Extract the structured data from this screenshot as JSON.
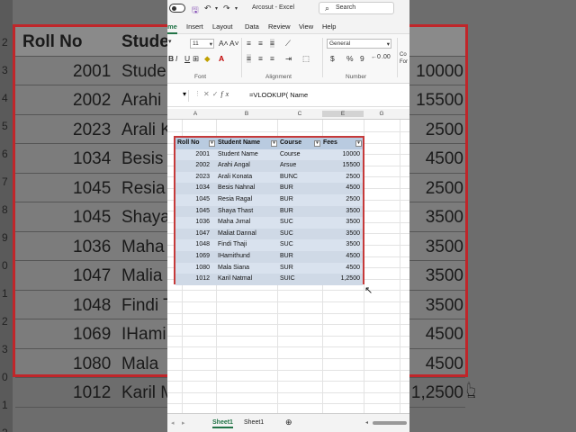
{
  "background": {
    "header": [
      "Roll No",
      "Stude"
    ],
    "rows": [
      [
        "2001",
        "Stude",
        "10000"
      ],
      [
        "2002",
        "Arahi",
        "15500"
      ],
      [
        "2023",
        "Arali K",
        "2500"
      ],
      [
        "1034",
        "Besis",
        "4500"
      ],
      [
        "1045",
        "Resia",
        "2500"
      ],
      [
        "1045",
        "Shaya",
        "3500"
      ],
      [
        "1036",
        "Maha",
        "3500"
      ],
      [
        "1047",
        "Malia",
        "3500"
      ],
      [
        "1048",
        "Findi T",
        "3500"
      ],
      [
        "1069",
        "IHami",
        "4500"
      ],
      [
        "1080",
        "Mala",
        "4500"
      ],
      [
        "1012",
        "Karil M",
        "1,2500"
      ]
    ],
    "row_numbers": [
      "2",
      "3",
      "4",
      "5",
      "6",
      "7",
      "8",
      "9",
      "0",
      "1",
      "2",
      "3",
      "0",
      "1",
      "2"
    ]
  },
  "titlebar": {
    "document": "Arcosut  -  Excel",
    "search_placeholder": "Search"
  },
  "tabs": [
    "me",
    "Insert",
    "Layout",
    "Data",
    "Review",
    "View",
    "Help"
  ],
  "ribbon": {
    "font_size": "11",
    "number_format": "General",
    "group_font": "Font",
    "group_alignment": "Alignment",
    "group_number": "Number",
    "currency": "$",
    "percent": "%",
    "comma": "9",
    "bold": "B",
    "italic": "I",
    "underline": "U",
    "cond_partial": "Co",
    "fmt_partial": "For"
  },
  "formula_bar": {
    "name_box": "",
    "formula": "=VLOOKUP( Name"
  },
  "columns": [
    "A",
    "B",
    "C",
    "E",
    "G"
  ],
  "table": {
    "headers": [
      "Roll No",
      "Student Name",
      "Course",
      "Fees"
    ],
    "rows": [
      [
        "2001",
        "Student Name",
        "Course",
        "10000"
      ],
      [
        "2002",
        "Arahi Angal",
        "Arsue",
        "15500"
      ],
      [
        "2023",
        "Arali Konata",
        "BUNC",
        "2500"
      ],
      [
        "1034",
        "Besis Nahnal",
        "BUR",
        "4500"
      ],
      [
        "1045",
        "Resia Ragal",
        "BUR",
        "2500"
      ],
      [
        "1045",
        "Shaya Thast",
        "BUR",
        "3500"
      ],
      [
        "1036",
        "Maha Jımal",
        "SUC",
        "3500"
      ],
      [
        "1047",
        "Maliat Dannal",
        "SUC",
        "3500"
      ],
      [
        "1048",
        "Findi Thaji",
        "SUC",
        "3500"
      ],
      [
        "1069",
        "IHamithund",
        "BUR",
        "4500"
      ],
      [
        "1080",
        "Mala Siana",
        "SUR",
        "4500"
      ],
      [
        "1012",
        "Karil Natmal",
        "SUIC",
        "1,2500"
      ]
    ]
  },
  "sheets": [
    "Sheet1",
    "Sheet1"
  ]
}
